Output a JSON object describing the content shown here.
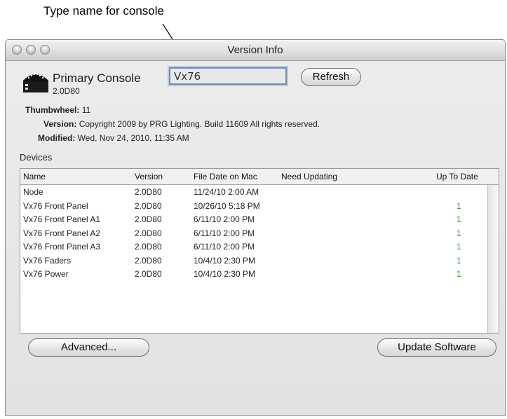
{
  "annotation": {
    "text": "Type name for console"
  },
  "window": {
    "title": "Version Info"
  },
  "console": {
    "name": "Primary Console",
    "version": "2.0D80",
    "name_field_value": "Vx76",
    "refresh_label": "Refresh"
  },
  "info": {
    "thumbwheel_label": "Thumbwheel:",
    "thumbwheel_value": "11",
    "version_label": "Version:",
    "version_value": "Copyright 2009 by PRG Lighting.  Build 11609 All rights reserved.",
    "modified_label": "Modified:",
    "modified_value": "Wed, Nov 24, 2010, 11:35 AM"
  },
  "devices": {
    "label": "Devices",
    "columns": [
      "Name",
      "Version",
      "File Date on Mac",
      "Need Updating",
      "Up To Date"
    ],
    "rows": [
      {
        "name": "Node",
        "version": "2.0D80",
        "date": "11/24/10 2:00 AM",
        "need": "",
        "uptodate": ""
      },
      {
        "name": "Vx76 Front Panel",
        "version": "2.0D80",
        "date": "10/26/10 5:18 PM",
        "need": "",
        "uptodate": "1"
      },
      {
        "name": "Vx76 Front Panel A1",
        "version": "2.0D80",
        "date": "6/11/10 2:00 PM",
        "need": "",
        "uptodate": "1"
      },
      {
        "name": "Vx76 Front Panel A2",
        "version": "2.0D80",
        "date": "6/11/10 2:00 PM",
        "need": "",
        "uptodate": "1"
      },
      {
        "name": "Vx76 Front Panel A3",
        "version": "2.0D80",
        "date": "6/11/10 2:00 PM",
        "need": "",
        "uptodate": "1"
      },
      {
        "name": "Vx76 Faders",
        "version": "2.0D80",
        "date": "10/4/10 2:30 PM",
        "need": "",
        "uptodate": "1"
      },
      {
        "name": "Vx76 Power",
        "version": "2.0D80",
        "date": "10/4/10 2:30 PM",
        "need": "",
        "uptodate": "1"
      }
    ]
  },
  "buttons": {
    "advanced_label": "Advanced...",
    "update_label": "Update Software"
  },
  "icons": {
    "window_controls": [
      "close-icon",
      "minimize-icon",
      "zoom-icon"
    ],
    "console_icon": "console-icon"
  },
  "colors": {
    "uptodate": "#2e9a2e",
    "focus_ring": "#7a8fae"
  }
}
